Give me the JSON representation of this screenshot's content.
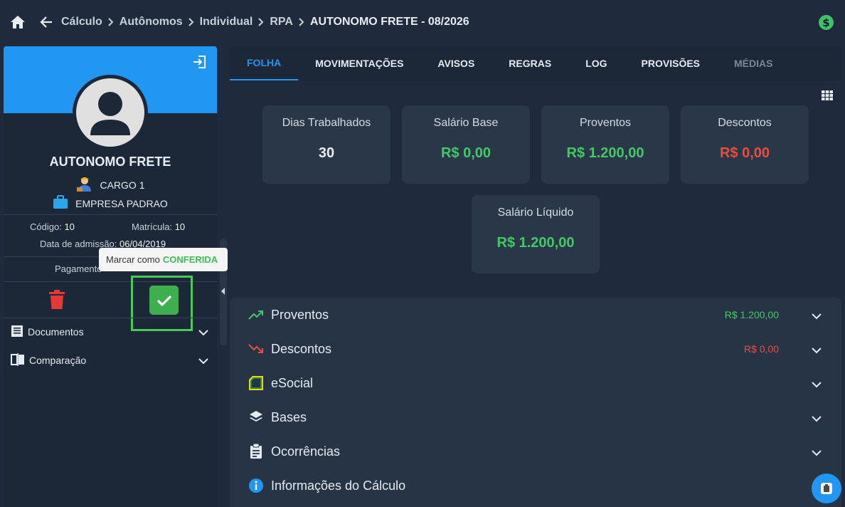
{
  "breadcrumb": {
    "items": [
      "Cálculo",
      "Autônomos",
      "Individual",
      "RPA"
    ],
    "current": "AUTONOMO FRETE - 08/2026"
  },
  "profile": {
    "name": "AUTONOMO FRETE",
    "cargo": "CARGO 1",
    "empresa": "EMPRESA PADRAO",
    "codigo_label": "Código:",
    "codigo": "10",
    "matricula_label": "Matrícula:",
    "matricula": "10",
    "admissao_label": "Data de admissão:",
    "admissao": "06/04/2019",
    "pagamento_label": "Pagamento"
  },
  "tooltip": {
    "prefix": "Marcar como",
    "status": "CONFERIDA"
  },
  "side_menu": [
    {
      "label": "Documentos",
      "icon": "document-icon"
    },
    {
      "label": "Comparação",
      "icon": "compare-icon"
    }
  ],
  "tabs": [
    {
      "label": "FOLHA",
      "state": "active"
    },
    {
      "label": "MOVIMENTAÇÕES",
      "state": "normal"
    },
    {
      "label": "AVISOS",
      "state": "normal"
    },
    {
      "label": "REGRAS",
      "state": "normal"
    },
    {
      "label": "LOG",
      "state": "normal"
    },
    {
      "label": "PROVISÕES",
      "state": "normal"
    },
    {
      "label": "MÉDIAS",
      "state": "disabled"
    }
  ],
  "cards": [
    {
      "title": "Dias Trabalhados",
      "value": "30"
    },
    {
      "title": "Salário Base",
      "value": "R$ 0,00"
    },
    {
      "title": "Proventos",
      "value": "R$ 1.200,00"
    },
    {
      "title": "Descontos",
      "value": "R$ 0,00"
    },
    {
      "title": "Salário Líquido",
      "value": "R$ 1.200,00"
    }
  ],
  "sections": [
    {
      "label": "Proventos",
      "value": "R$ 1.200,00",
      "icon": "trending-up-icon"
    },
    {
      "label": "Descontos",
      "value": "R$ 0,00",
      "icon": "trending-down-icon"
    },
    {
      "label": "eSocial",
      "value": "",
      "icon": "esocial-icon"
    },
    {
      "label": "Bases",
      "value": "",
      "icon": "layers-icon"
    },
    {
      "label": "Ocorrências",
      "value": "",
      "icon": "clipboard-icon"
    },
    {
      "label": "Informações do Cálculo",
      "value": "",
      "icon": "info-icon"
    }
  ],
  "colors": {
    "accent": "#2196f3",
    "positive": "#44c767",
    "negative": "#e94d3f",
    "background": "#1f2b3c"
  }
}
